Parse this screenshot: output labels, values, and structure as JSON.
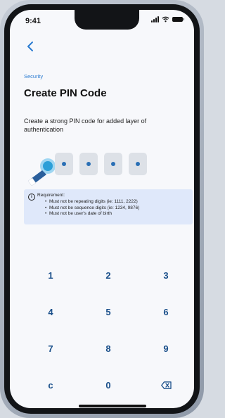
{
  "status_bar": {
    "time": "9:41"
  },
  "header": {
    "section": "Security",
    "title": "Create PIN Code",
    "subtitle": "Create a strong PIN code for added layer of authentication"
  },
  "pin": {
    "filled": 4,
    "length": 4
  },
  "requirements": {
    "title": "Requirement:",
    "items": [
      "Must not be repeating digits (ie: 1111, 2222)",
      "Must not be sequence digits (ie: 1234, 9876)",
      "Must not be user's date of birth"
    ]
  },
  "keypad": {
    "keys": [
      "1",
      "2",
      "3",
      "4",
      "5",
      "6",
      "7",
      "8",
      "9",
      "c",
      "0"
    ]
  },
  "colors": {
    "accent": "#2a7bd1",
    "key_text": "#1a4f8a",
    "req_bg": "#dfe8fa"
  }
}
